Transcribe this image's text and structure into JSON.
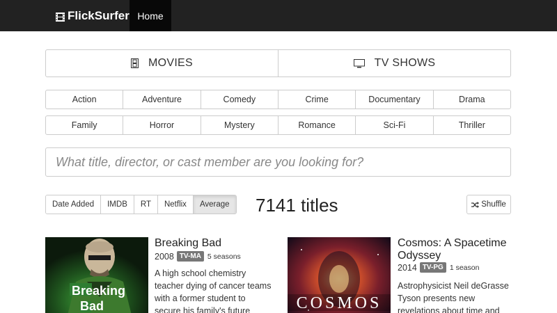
{
  "navbar": {
    "brand": "FlickSurfer",
    "brand_icon": "film-icon",
    "home_label": "Home"
  },
  "media_tabs": [
    {
      "label": "MOVIES",
      "icon": "film-icon"
    },
    {
      "label": "TV SHOWS",
      "icon": "tv-icon"
    }
  ],
  "genres": {
    "row1": [
      "Action",
      "Adventure",
      "Comedy",
      "Crime",
      "Documentary",
      "Drama"
    ],
    "row2": [
      "Family",
      "Horror",
      "Mystery",
      "Romance",
      "Sci-Fi",
      "Thriller"
    ]
  },
  "search": {
    "placeholder": "What title, director, or cast member are you looking for?",
    "value": ""
  },
  "sort": {
    "options": [
      "Date Added",
      "IMDB",
      "RT",
      "Netflix",
      "Average"
    ],
    "selected": "Average"
  },
  "title_count": "7141 titles",
  "shuffle_label": "Shuffle",
  "results": [
    {
      "title": "Breaking Bad",
      "year": "2008",
      "rating": "TV-MA",
      "seasons": "5 seasons",
      "description": "A high school chemistry teacher dying of cancer teams with a former student to secure his family's future",
      "poster_text": [
        "Br",
        "eaking",
        "Bad"
      ]
    },
    {
      "title": "Cosmos: A Spacetime Odyssey",
      "year": "2014",
      "rating": "TV-PG",
      "seasons": "1 season",
      "description": "Astrophysicist Neil deGrasse Tyson presents new revelations about time and",
      "poster_text": "COSMOS"
    }
  ],
  "colors": {
    "navbar_bg": "#222222",
    "nav_active_bg": "#080808",
    "border": "#cccccc",
    "rating_badge": "#777777"
  }
}
